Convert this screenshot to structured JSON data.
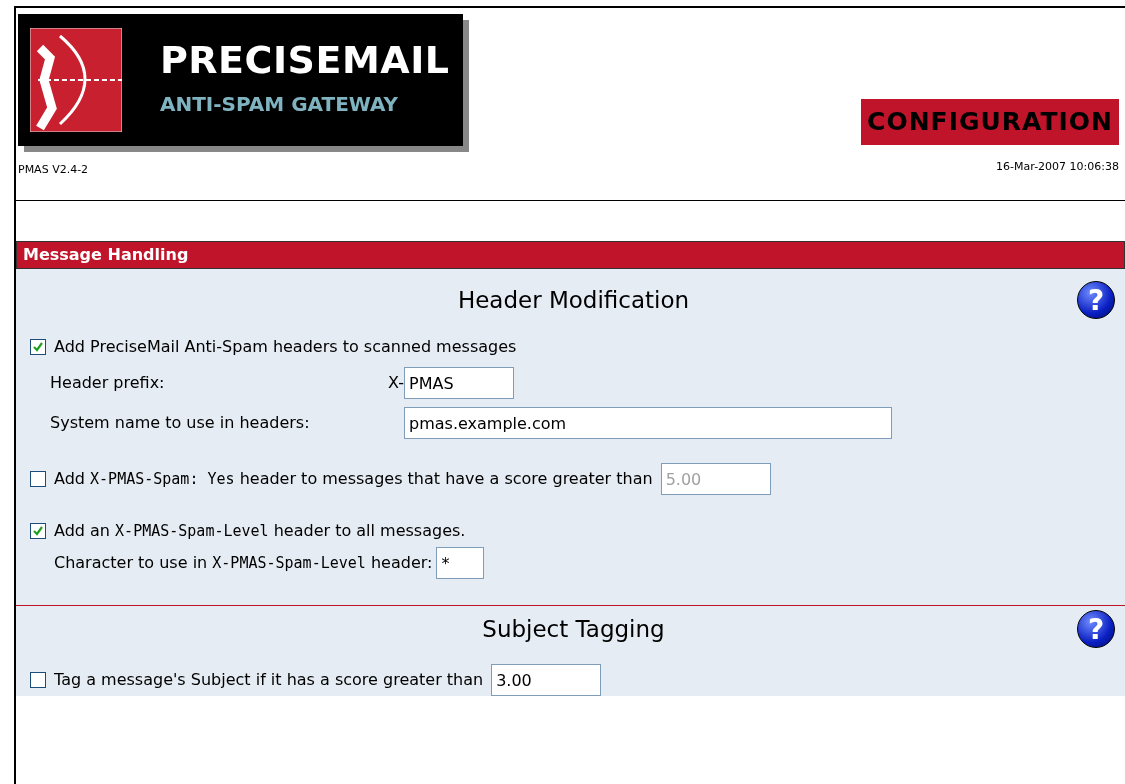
{
  "logo": {
    "title": "PRECISEMAIL",
    "subtitle": "ANTI-SPAM GATEWAY"
  },
  "version": "PMAS V2.4-2",
  "page_badge": "CONFIGURATION",
  "timestamp": "16-Mar-2007 10:06:38",
  "panel": {
    "title": "Message Handling",
    "sections": [
      {
        "title": "Header Modification",
        "help": "?",
        "options": [
          {
            "checked": true,
            "label": [
              {
                "text": "Add PreciseMail Anti-Spam headers to scanned messages"
              }
            ],
            "subfields": [
              {
                "kind": "row",
                "label": [
                  {
                    "text": "Header prefix:"
                  }
                ],
                "prefix": "X-",
                "value": "PMAS"
              },
              {
                "kind": "row",
                "label": [
                  {
                    "text": "System name to use in headers:"
                  }
                ],
                "value": "pmas.example.com"
              }
            ]
          },
          {
            "checked": false,
            "label": [
              {
                "text": "Add "
              },
              {
                "text": "X-PMAS-Spam: Yes",
                "code": true
              },
              {
                "text": " header to messages that have a score greater than"
              }
            ],
            "input": {
              "value": "5.00",
              "disabled": true
            }
          },
          {
            "checked": true,
            "label": [
              {
                "text": "Add an "
              },
              {
                "text": "X-PMAS-Spam-Level",
                "code": true
              },
              {
                "text": " header to all messages."
              }
            ],
            "subfields": [
              {
                "kind": "inline",
                "label": [
                  {
                    "text": "Character to use in "
                  },
                  {
                    "text": "X-PMAS-Spam-Level",
                    "code": true
                  },
                  {
                    "text": " header:"
                  }
                ],
                "value": "*"
              }
            ]
          }
        ]
      },
      {
        "title": "Subject Tagging",
        "help": "?",
        "options": [
          {
            "checked": false,
            "label": [
              {
                "text": "Tag a message's Subject if it has a score greater than"
              }
            ],
            "input": {
              "value": "3.00",
              "disabled": false
            }
          }
        ]
      }
    ]
  }
}
